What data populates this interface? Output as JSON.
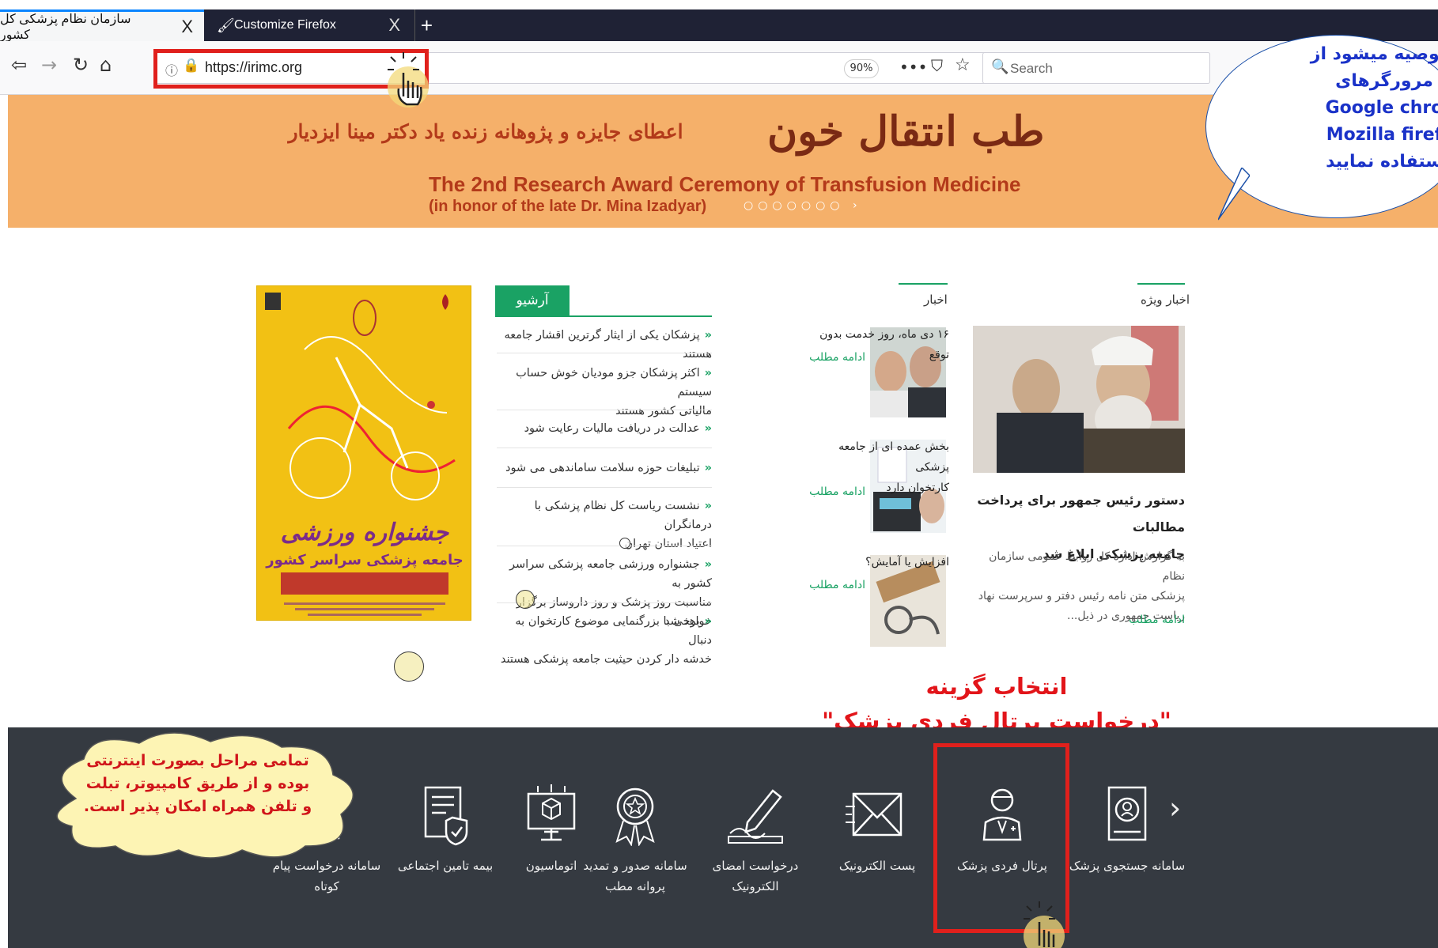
{
  "browser": {
    "tabs": [
      {
        "title": "سازمان نظام پزشکی کل کشور",
        "close": "X"
      },
      {
        "title": "Customize Firefox",
        "close": "X"
      }
    ],
    "new_tab": "+",
    "url": "https://irimc.org",
    "zoom": "90%",
    "search_placeholder": "Search",
    "more_glyph": "•••"
  },
  "banner": {
    "fa_main": "طب انتقال خون",
    "fa_sub": "اعطای جایزه و پژوهانه زنده یاد دکتر مینا ایزدیار",
    "en_line1": "The 2nd Research Award Ceremony of Transfusion Medicine",
    "en_line2": "(in honor of the late Dr. Mina Izadyar)"
  },
  "callouts": {
    "browser_tip_lines": [
      "ا توصیه میشود از",
      "مرورگرهای",
      "Google chro",
      "Mozilla firef",
      "ستفاده نمایید"
    ],
    "select_option_lines": [
      "انتخاب گزینه",
      "\"درخواست پرتال فردی پزشک\""
    ],
    "cloud_lines": [
      "تمامی مراحل بصورت اینترنتی",
      "بوده و از طریق کامپیوتر، تبلت",
      "و تلفن همراه امکان پذیر است."
    ]
  },
  "sections": {
    "featured": {
      "heading": "اخبار ویژه",
      "title_lines": [
        "دستور رئیس جمهور برای پرداخت مطالبات",
        "جامعه پزشکی ابلاغ شد"
      ],
      "body_lines": [
        "به گزارش اداره کل روابط عمومی سازمان نظام",
        "پزشکی متن نامه رئیس دفتر و سرپرست نهاد",
        "ریاست جمهوری در ذیل..."
      ],
      "more": "ادامه مطلب"
    },
    "news": {
      "heading": "اخبار",
      "items": [
        {
          "title_lines": [
            "۱۶ دی ماه، روز خدمت بدون توقع"
          ],
          "more": "ادامه مطلب"
        },
        {
          "title_lines": [
            "بخش عمده ای از جامعه پزشکی",
            "کارتخوان دارد"
          ],
          "more": "ادامه مطلب"
        },
        {
          "title_lines": [
            "افزایش یا آمایش؟"
          ],
          "more": "ادامه مطلب"
        }
      ]
    },
    "archive": {
      "heading": "آرشیو",
      "items": [
        [
          "پزشکان یکی از ایثار گرترین اقشار جامعه هستند"
        ],
        [
          "اکثر پزشکان جزو مودیان خوش حساب سیستم",
          "مالیاتی کشور هستند"
        ],
        [
          "عدالت در دریافت مالیات رعایت شود"
        ],
        [
          "تبلیغات حوزه سلامت ساماندهی می شود"
        ],
        [
          "نشست ریاست کل نظام پزشکی با درمانگران",
          "اعتیاد استان تهران"
        ],
        [
          "جشنواره ورزشی جامعه پزشکی سراسر کشور به",
          "مناسبت روز پزشک و روز داروساز برگزار خواهد شد"
        ],
        [
          "برخی با بزرگنمایی موضوع کارتخوان به دنبال",
          "خدشه دار کردن حیثیت جامعه پزشکی هستند"
        ]
      ]
    },
    "poster": {
      "title": "جشنواره ورزشی",
      "subtitle": "جامعه پزشکی سراسر کشور"
    }
  },
  "services": [
    {
      "label_lines": [
        "سامانه جستجوی پزشک"
      ],
      "icon": "doctor-search-icon"
    },
    {
      "label_lines": [
        "پرتال فردی پزشک"
      ],
      "icon": "doctor-portal-icon"
    },
    {
      "label_lines": [
        "پست الکترونیک"
      ],
      "icon": "email-icon"
    },
    {
      "label_lines": [
        "درخواست امضای",
        "الکترونیک"
      ],
      "icon": "e-signature-icon"
    },
    {
      "label_lines": [
        "سامانه صدور و تمدید",
        "پروانه مطب"
      ],
      "icon": "license-badge-icon"
    },
    {
      "label_lines": [
        "اتوماسیون"
      ],
      "icon": "automation-icon"
    },
    {
      "label_lines": [
        "بیمه تامین اجتماعی"
      ],
      "icon": "insurance-shield-icon"
    },
    {
      "label_lines": [
        "سامانه درخواست پیام",
        "کوتاه"
      ],
      "icon": "sms-request-icon"
    }
  ],
  "colors": {
    "accent_green": "#1aa264",
    "footer_bg": "#353a41",
    "highlight_red": "#e0201c",
    "banner_orange": "#f5b06a"
  }
}
